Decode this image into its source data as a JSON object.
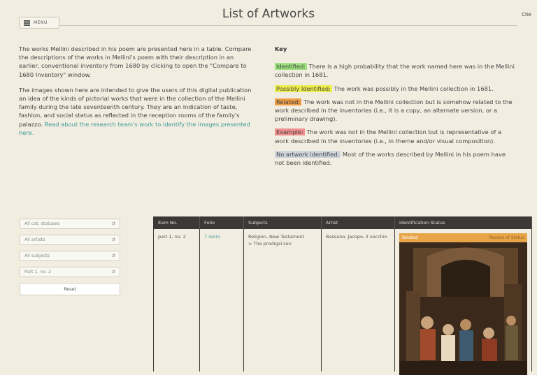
{
  "header": {
    "menu_label": "MENU",
    "title": "List of Artworks",
    "cite_label": "Cite"
  },
  "intro": {
    "p1": "The works Mellini described in his poem are presented here in a table. Compare the descriptions of the works in Mellini's poem with their description in an earlier, conventional inventory from 1680 by clicking to open the \"Compare to 1680 Inventory\" window.",
    "p2_text": "The images shown here are intended to give the users of this digital publication an idea of the kinds of pictorial works that were in the collection of the Mellini family during the late seventeenth century. They are an indication of taste, fashion, and social status as reflected in the reception rooms of the family's palazzo.",
    "p2_link": "Read about the research team's work to identify the images presented here."
  },
  "key": {
    "heading": "Key",
    "entries": [
      {
        "tag": "Identified:",
        "text": "There is a high probability that the work named here was in the Mellini collection in 1681.",
        "color": "#9de37e"
      },
      {
        "tag": "Possibly Identified:",
        "text": "The work was possibly in the Mellini collection in 1681.",
        "color": "#eded4a"
      },
      {
        "tag": "Related:",
        "text": "The work was not in the Mellini collection but is somehow related to the work described in the inventories (i.e., it is a copy, an alternate version, or a preliminary drawing).",
        "color": "#ef9d43"
      },
      {
        "tag": "Example:",
        "text": "The work was not in the Mellini collection but is representative of a work described in the inventories (i.e., in theme and/or visual composition).",
        "color": "#ef8f8f"
      },
      {
        "tag": "No artwork identified:",
        "text": "Most of the works described by Mellini in his poem have not been identified.",
        "color": "#cfd5de"
      }
    ]
  },
  "filters": {
    "selects": [
      "All cat. statuses",
      "All artists",
      "All subjects",
      "Part 1, no. 2"
    ],
    "reset_label": "Reset"
  },
  "table": {
    "headers": [
      "Item No.",
      "Folio",
      "Subjects",
      "Artist",
      "Identification Status"
    ],
    "rows": [
      {
        "item_no": "part 1, no. 2",
        "folio": "7 recto",
        "subjects": [
          "Religion, New Testament",
          "> The prodigal son"
        ],
        "artist": "Bassano, Jacopo, il vecchio",
        "status": "Related",
        "status_reason": "Reason of Status",
        "status_color": "#e7a548"
      }
    ]
  }
}
